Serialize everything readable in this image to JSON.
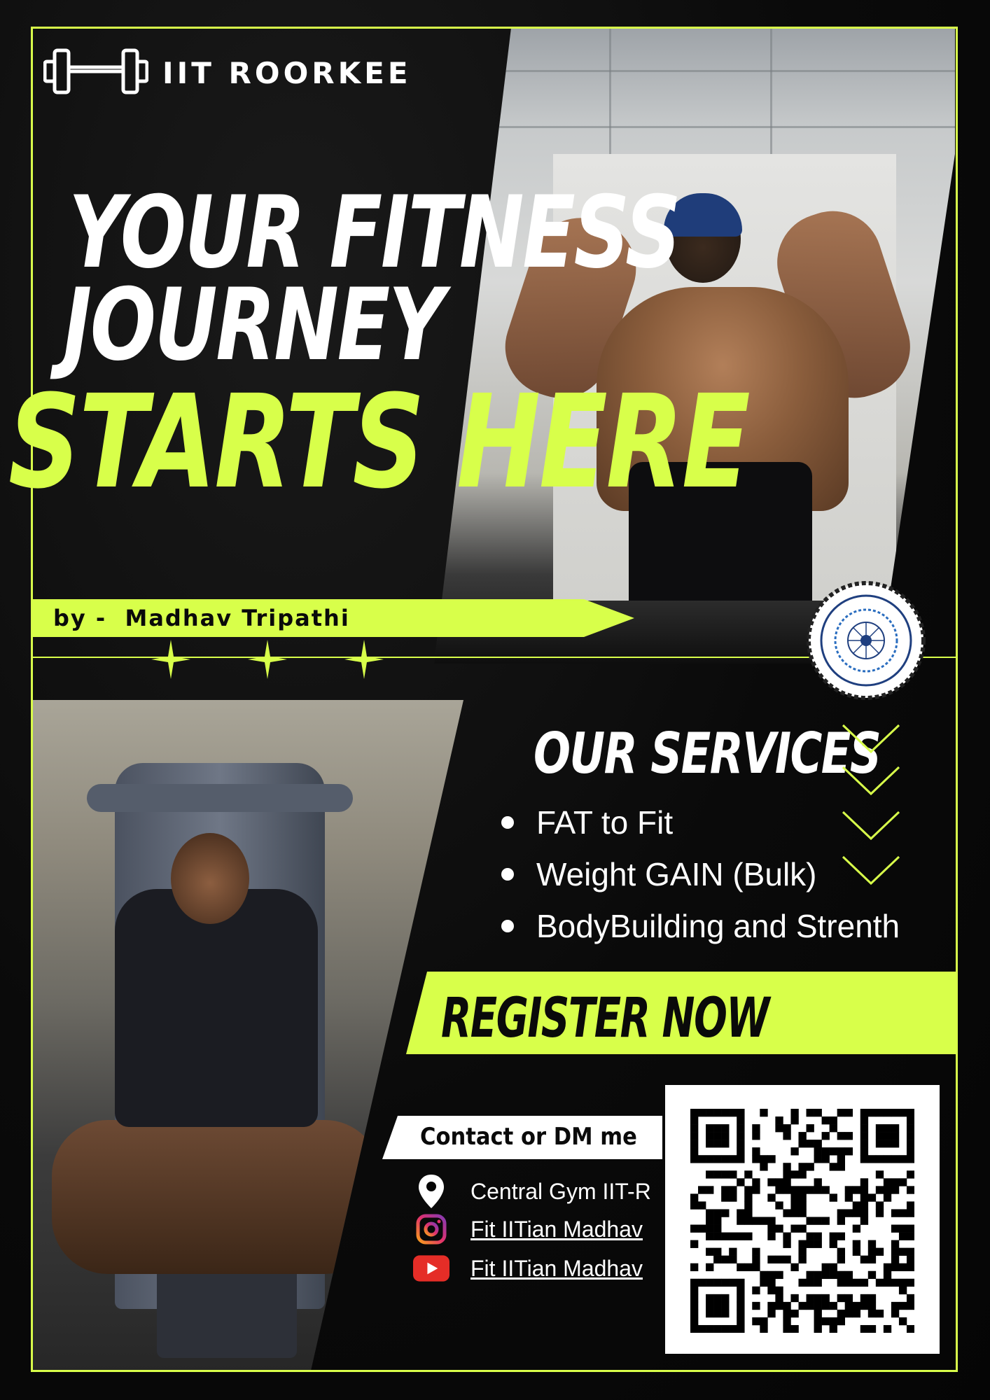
{
  "brand": {
    "title": "IIT ROORKEE",
    "icon": "dumbbell-icon"
  },
  "headline": {
    "line1": "YOUR FITNESS",
    "line2": "JOURNEY",
    "line3": "STARTS HERE"
  },
  "byline": "by -  Madhav Tripathi",
  "services": {
    "title": "OUR SERVICES",
    "items": [
      "FAT to Fit",
      "Weight GAIN (Bulk)",
      "BodyBuilding and Strenth"
    ]
  },
  "register": {
    "label": "REGISTER NOW"
  },
  "contact": {
    "heading": "Contact or DM me",
    "location": "Central Gym IIT-R",
    "instagram": "Fit IITian Madhav",
    "youtube": "Fit IITian Madhav"
  },
  "colors": {
    "accent": "#d8ff4a",
    "background": "#050505",
    "text": "#ffffff"
  }
}
